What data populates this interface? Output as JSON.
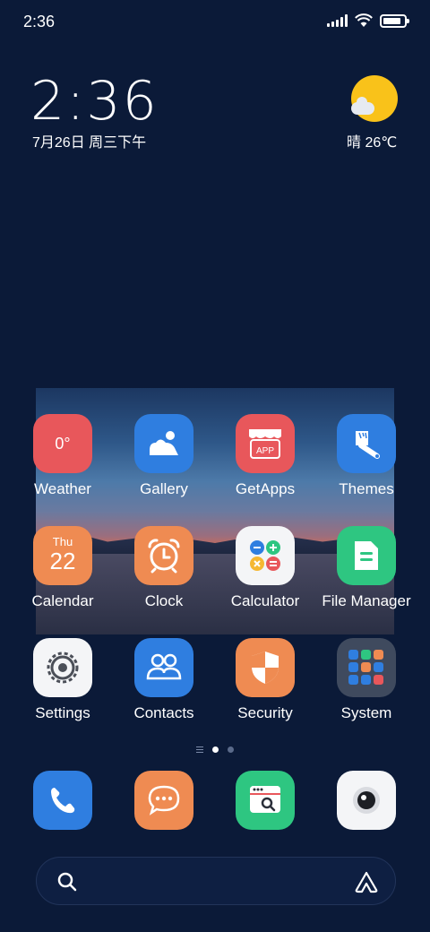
{
  "status_bar": {
    "time": "2:36",
    "battery_level": 0.85
  },
  "clock_widget": {
    "time": "2:36",
    "date": "7月26日 周三下午"
  },
  "weather_widget": {
    "text": "晴 26℃",
    "icon": "sunny-partly-cloudy-icon"
  },
  "apps": [
    {
      "label": "Weather",
      "icon": "weather-icon",
      "icon_text": "0°",
      "color": "#e8575b"
    },
    {
      "label": "Gallery",
      "icon": "gallery-icon",
      "color": "#2f7ee0"
    },
    {
      "label": "GetApps",
      "icon": "getapps-store-icon",
      "icon_text": "APP",
      "color": "#e8575b"
    },
    {
      "label": "Themes",
      "icon": "themes-brush-icon",
      "color": "#2f7ee0"
    },
    {
      "label": "Calendar",
      "icon": "calendar-icon",
      "icon_day": "Thu",
      "icon_date": "22",
      "color": "#ef8b52"
    },
    {
      "label": "Clock",
      "icon": "alarm-clock-icon",
      "color": "#ef8b52"
    },
    {
      "label": "Calculator",
      "icon": "calculator-icon",
      "color": "#f4f5f7"
    },
    {
      "label": "File Manager",
      "icon": "file-manager-icon",
      "color": "#2ec681"
    },
    {
      "label": "Settings",
      "icon": "settings-gear-icon",
      "color": "#f4f5f7"
    },
    {
      "label": "Contacts",
      "icon": "contacts-icon",
      "color": "#2f7ee0"
    },
    {
      "label": "Security",
      "icon": "security-shield-icon",
      "color": "#ef8b52"
    },
    {
      "label": "System",
      "icon": "system-folder-icon",
      "color": "#3f4a5e"
    }
  ],
  "dock": [
    {
      "icon": "phone-icon",
      "color": "#2f7ee0"
    },
    {
      "icon": "messaging-icon",
      "color": "#ef8b52"
    },
    {
      "icon": "browser-icon",
      "color": "#2ec681"
    },
    {
      "icon": "camera-icon",
      "color": "#f4f5f7"
    }
  ],
  "page_indicator": {
    "pages": 2,
    "active": 1
  },
  "search_bar": {
    "left_icon": "search-icon",
    "right_icon": "assistant-icon"
  }
}
